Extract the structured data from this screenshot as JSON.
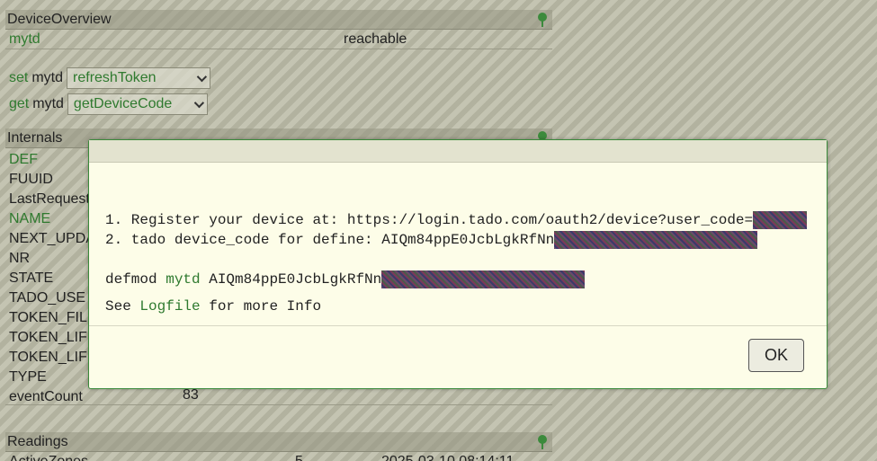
{
  "device_overview": {
    "title": "DeviceOverview",
    "device_name": "mytd",
    "status": "reachable"
  },
  "commands": {
    "set_label": "set",
    "set_device": "mytd",
    "set_value": "refreshToken",
    "get_label": "get",
    "get_device": "mytd",
    "get_value": "getDeviceCode"
  },
  "internals": {
    "title": "Internals",
    "items": [
      "DEF",
      "FUUID",
      "LastRequest",
      "NAME",
      "NEXT_UPDA",
      "NR",
      "STATE",
      "TADO_USE",
      "TOKEN_FIL",
      "TOKEN_LIF",
      "TOKEN_LIF",
      "TYPE",
      "eventCount"
    ],
    "eventCount_value": "83"
  },
  "readings": {
    "title": "Readings",
    "first_row_name": "ActiveZones",
    "first_row_value": "5",
    "first_row_time": "2025-03-10 08:14:11"
  },
  "dialog": {
    "line1_prefix": "1. Register your device at: https://login.tado.com/oauth2/device?user_code=",
    "line2_prefix": "2. tado device_code for define: AIQm84ppE0JcbLgkRfNn",
    "defmod_keyword": "defmod ",
    "defmod_device": "mytd",
    "defmod_code": " AIQm84ppE0JcbLgkRfNn",
    "see_prefix": "See ",
    "logfile_link": "Logfile",
    "see_suffix": " for more Info",
    "ok_label": "OK"
  }
}
